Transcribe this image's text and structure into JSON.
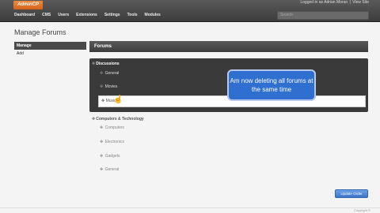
{
  "brand": {
    "logo": "AdminCP"
  },
  "toplinks": {
    "logged_in": "Logged in as Adrian Moran",
    "separator": "|",
    "view_site": "View Site"
  },
  "nav": {
    "items": [
      "Dashboard",
      "CMS",
      "Users",
      "Extensions",
      "Settings",
      "Tools",
      "Modules"
    ]
  },
  "search": {
    "placeholder": "Search"
  },
  "page": {
    "title": "Manage Forums"
  },
  "sidebar": {
    "items": [
      {
        "label": "Manage",
        "active": true
      },
      {
        "label": "Add",
        "active": false
      }
    ]
  },
  "panel": {
    "header": "Forums"
  },
  "tree": {
    "categories": [
      {
        "name": "Discussions",
        "forums": [
          "General",
          "Movies",
          "Music"
        ]
      },
      {
        "name": "Computers & Technology",
        "forums": [
          "Computers",
          "Electronics",
          "Gadgets",
          "General"
        ]
      }
    ]
  },
  "tooltip": {
    "text": "Am now deleting all forums at the same time"
  },
  "actions": {
    "update_order": "Update Order"
  },
  "footer": {
    "text": "Copyright ©"
  },
  "colors": {
    "topbar": "#3c3c3c",
    "brand": "#e07a2e",
    "tooltip": "#2f6fd0",
    "button": "#4a86d8"
  }
}
